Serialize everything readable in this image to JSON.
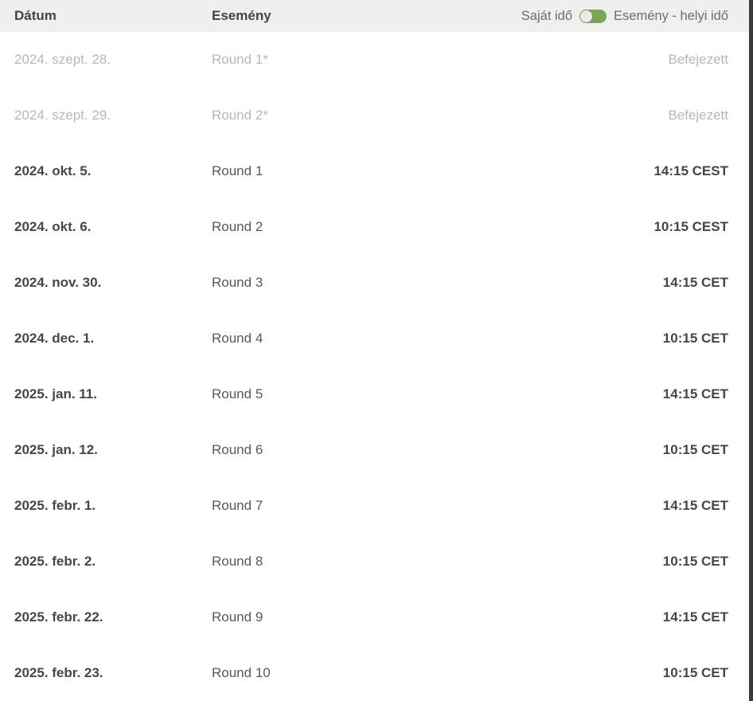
{
  "header": {
    "col_date": "Dátum",
    "col_event": "Esemény",
    "tz_left_label": "Saját idő",
    "tz_right_label": "Esemény - helyi idő",
    "toggle_state": "right",
    "toggle_track_color": "#7ba455",
    "toggle_knob_color": "#ebeae8",
    "background_color": "#f0efee"
  },
  "rows": [
    {
      "date": "2024. szept. 28.",
      "event": "Round 1*",
      "time": "Befejezett",
      "completed": true
    },
    {
      "date": "2024. szept. 29.",
      "event": "Round 2*",
      "time": "Befejezett",
      "completed": true
    },
    {
      "date": "2024. okt. 5.",
      "event": "Round 1",
      "time": "14:15 CEST",
      "completed": false
    },
    {
      "date": "2024. okt. 6.",
      "event": "Round 2",
      "time": "10:15 CEST",
      "completed": false
    },
    {
      "date": "2024. nov. 30.",
      "event": "Round 3",
      "time": "14:15 CET",
      "completed": false
    },
    {
      "date": "2024. dec. 1.",
      "event": "Round 4",
      "time": "10:15 CET",
      "completed": false
    },
    {
      "date": "2025. jan. 11.",
      "event": "Round 5",
      "time": "14:15 CET",
      "completed": false
    },
    {
      "date": "2025. jan. 12.",
      "event": "Round 6",
      "time": "10:15 CET",
      "completed": false
    },
    {
      "date": "2025. febr. 1.",
      "event": "Round 7",
      "time": "14:15 CET",
      "completed": false
    },
    {
      "date": "2025. febr. 2.",
      "event": "Round 8",
      "time": "10:15 CET",
      "completed": false
    },
    {
      "date": "2025. febr. 22.",
      "event": "Round 9",
      "time": "14:15 CET",
      "completed": false
    },
    {
      "date": "2025. febr. 23.",
      "event": "Round 10",
      "time": "10:15 CET",
      "completed": false
    }
  ]
}
